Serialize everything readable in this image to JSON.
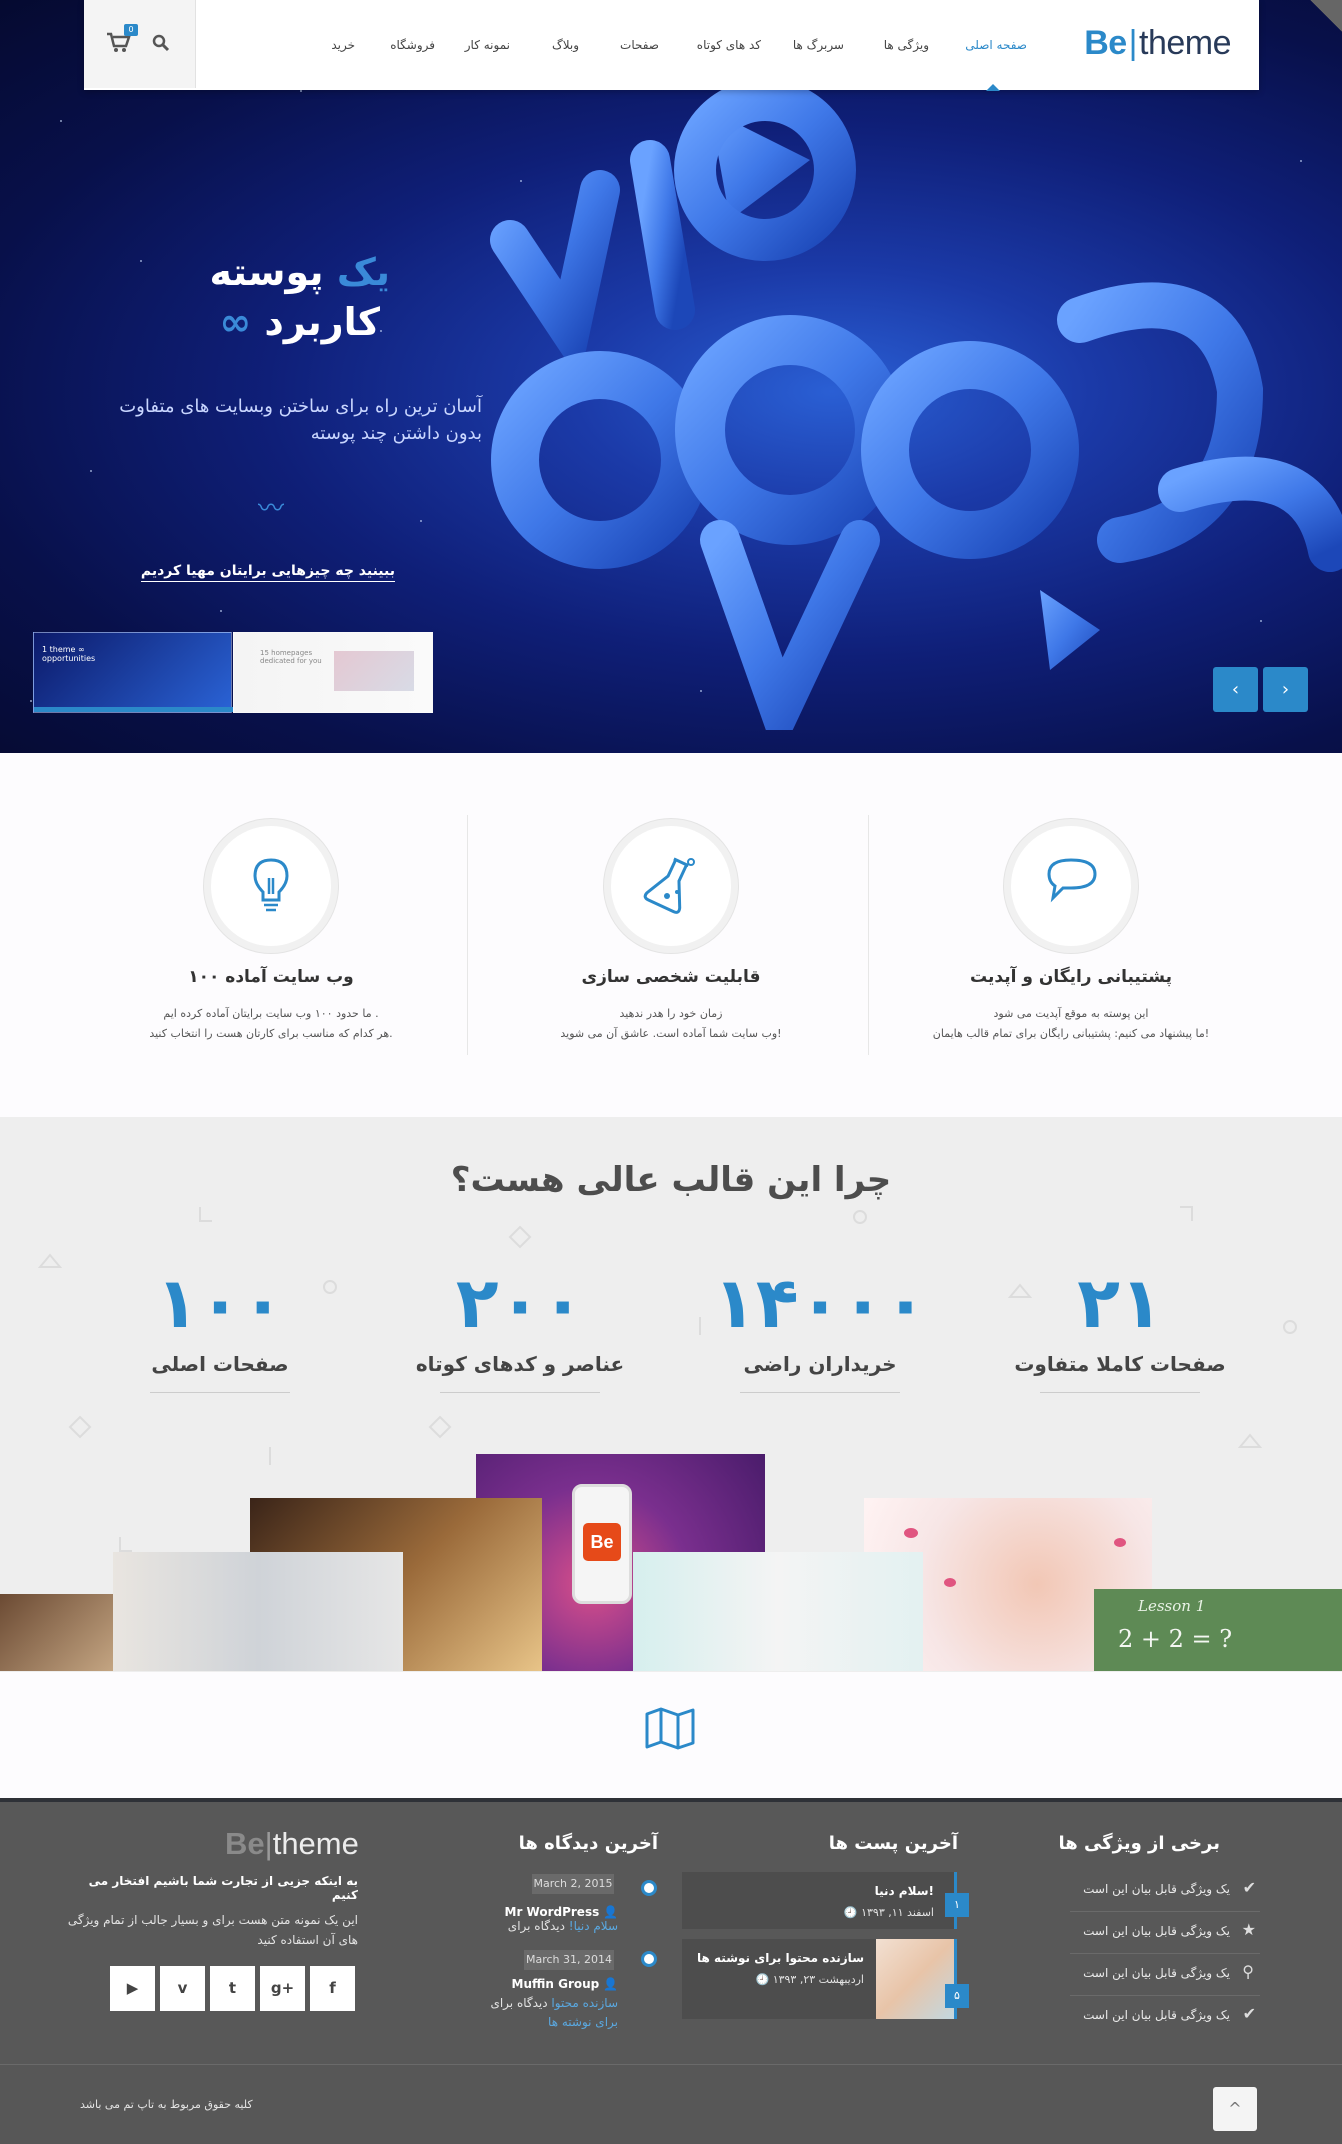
{
  "nav": {
    "logo_be": "Be",
    "logo_rest": "theme",
    "items": [
      "صفحه اصلی",
      "ویژگی ها",
      "سربرگ ها",
      "کد های کوتاه",
      "صفحات",
      "وبلاگ",
      "نمونه کار",
      "فروشگاه",
      "خرید"
    ],
    "cart_count": "0"
  },
  "hero": {
    "title_accent": "یک",
    "title_rest": "پوسته",
    "title2_accent": "∞",
    "title2_rest": "کاربرد",
    "subtitle_line1": "آسان ترین راه برای ساختن وبسایت های متفاوت",
    "subtitle_line2": "بدون داشتن چند پوسته",
    "squiggle": "〰",
    "link": "ببینید چه چیزهایی برایتان مهیا کردیم",
    "thumb1_title": "1 theme ∞ opportunities",
    "thumb2_title": "15 homepages dedicated for you",
    "prev": "‹",
    "next": "›"
  },
  "features": [
    {
      "title": "پشتیبانی رایگان و آپدیت",
      "line1": "این پوسته به موقع آپدیت می شود",
      "line2": "ما پیشنهاد می کنیم: پشتیبانی رایگان برای تمام قالب هایمان!",
      "icon": "speech-bubble-icon"
    },
    {
      "title": "قابلیت شخصی سازی",
      "line1": "زمان خود را هدر ندهید",
      "line2": "وب سایت شما آماده است. عاشق آن می شوید!",
      "icon": "flask-icon"
    },
    {
      "title": "۱۰۰ وب سایت آماده",
      "line1": "ما حدود ۱۰۰ وب سایت برایتان آماده کرده ایم .",
      "line2": "هر کدام که مناسب برای کارتان هست را انتخاب کنید.",
      "icon": "lightbulb-icon"
    }
  ],
  "why": {
    "title": "چرا این قالب عالی هست؟",
    "counters": [
      {
        "value": "۲۱",
        "label": "صفحات کاملا متفاوت"
      },
      {
        "value": "۱۴۰۰۰",
        "label": "خریداران راضی"
      },
      {
        "value": "۲۰۰",
        "label": "عناصر و کدهای کوتاه"
      },
      {
        "value": "۱۰۰",
        "label": "صفحات اصلی"
      }
    ],
    "lesson_text": "Lesson 1",
    "lesson_eq": "2 + 2 = ?"
  },
  "footer": {
    "features_title": "برخی از ویژگی ها",
    "feature_items": [
      "یک ویژگی قابل بیان این است",
      "یک ویژگی قابل بیان این است",
      "یک ویژگی قابل بیان این است",
      "یک ویژگی قابل بیان این است"
    ],
    "posts_title": "آخرین پست ها",
    "posts": [
      {
        "title": "سلام دنیا!",
        "date": "اسفند ۱۱, ۱۳۹۳",
        "badge": "۱"
      },
      {
        "title": "سازنده محتوا برای نوشته ها",
        "date": "اردیبهشت ۲۳, ۱۳۹۳",
        "badge": "۵"
      }
    ],
    "comments_title": "آخرین دیدگاه ها",
    "comments": [
      {
        "date": "March 2, 2015",
        "author": "Mr WordPress",
        "text": "دیدگاه برای",
        "link": "سلام دنیا!",
        "link2": ""
      },
      {
        "date": "March 31, 2014",
        "author": "Muffin Group",
        "text": "دیدگاه برای",
        "link": "سازنده محتوا",
        "link2": "برای نوشته ها"
      }
    ],
    "about_logo_be": "Be",
    "about_logo_rest": "theme",
    "about_bold": "به اینکه جزیی از تجارت شما باشیم افتخار می کنیم",
    "about_line1": "این یک نمونه متن هست برای و بسیار جالب از تمام ویژگی",
    "about_line2": "های آن استفاده کنید",
    "social": [
      "▶",
      "v",
      "t",
      "g+",
      "f"
    ],
    "copyright": "کلیه حقوق مربوط به تاپ تم می باشد",
    "top_button": "^"
  }
}
